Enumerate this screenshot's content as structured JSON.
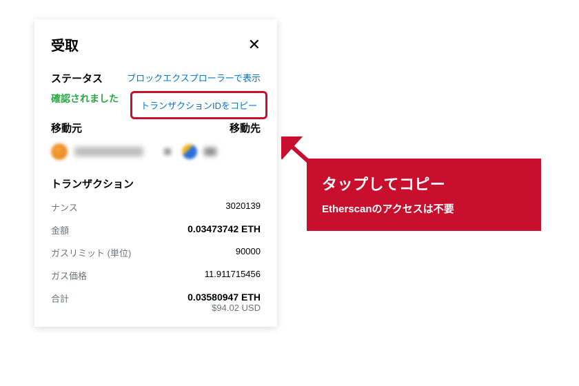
{
  "card": {
    "title": "受取",
    "status_label": "ステータス",
    "status_value": "確認されました",
    "link_explorer": "ブロックエクスプローラーで表示",
    "link_copy_txid": "トランザクションIDをコピー",
    "from_label": "移動元",
    "to_label": "移動先",
    "tx_section": "トランザクション",
    "rows": {
      "nonce_label": "ナンス",
      "nonce_value": "3020139",
      "amount_label": "金額",
      "amount_value": "0.03473742 ETH",
      "gaslimit_label": "ガスリミット (単位)",
      "gaslimit_value": "90000",
      "gasprice_label": "ガス価格",
      "gasprice_value": "11.911715456",
      "total_label": "合計",
      "total_value": "0.03580947 ETH",
      "total_sub": "$94.02 USD"
    }
  },
  "callout": {
    "title": "タップしてコピー",
    "sub": "Etherscanのアクセスは不要"
  }
}
